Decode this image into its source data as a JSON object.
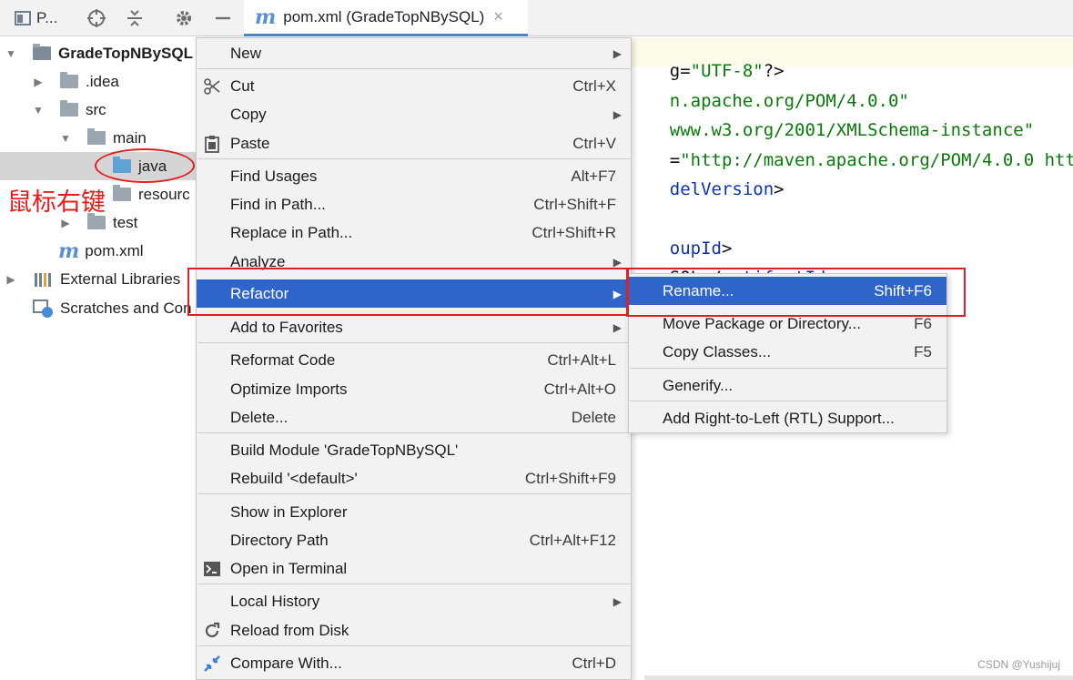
{
  "toolbar": {
    "project_label": "P...",
    "editor_tab": {
      "title": "pom.xml (GradeTopNBySQL)",
      "close": "×"
    }
  },
  "tree": {
    "root": "GradeTopNBySQL",
    "idea": ".idea",
    "src": "src",
    "main": "main",
    "java": "java",
    "resources": "resourc",
    "test": "test",
    "pom": "pom.xml",
    "external_libraries": "External Libraries",
    "scratches": "Scratches and Con"
  },
  "annotation": "鼠标右键",
  "editor": {
    "lines": [
      {
        "a": "g=",
        "b": "\"UTF-8\"",
        "c": "?>"
      },
      {
        "a": "",
        "b": "n.apache.org/POM/4.0.0\"",
        "c": ""
      },
      {
        "a": "",
        "b": "www.w3.org/2001/XMLSchema-instance\"",
        "c": ""
      },
      {
        "a": "=",
        "b": "\"http://maven.apache.org/POM/4.0.0 http:",
        "c": ""
      },
      {
        "a": "",
        "b": "delVersion",
        "c": ">"
      },
      {
        "a": "",
        "b": "oupId",
        "c": ">"
      },
      {
        "a": "SQL</",
        "b": "artifactId",
        "c": ">"
      }
    ]
  },
  "menu": {
    "items": [
      {
        "label": "New",
        "shortcut": "",
        "submenu": true,
        "icon": ""
      },
      {
        "label": "Cut",
        "shortcut": "Ctrl+X",
        "submenu": false,
        "icon": "scissors-icon"
      },
      {
        "label": "Copy",
        "shortcut": "",
        "submenu": true,
        "icon": ""
      },
      {
        "label": "Paste",
        "shortcut": "Ctrl+V",
        "submenu": false,
        "icon": "clipboard-icon"
      },
      {
        "label": "Find Usages",
        "shortcut": "Alt+F7",
        "submenu": false,
        "icon": ""
      },
      {
        "label": "Find in Path...",
        "shortcut": "Ctrl+Shift+F",
        "submenu": false,
        "icon": ""
      },
      {
        "label": "Replace in Path...",
        "shortcut": "Ctrl+Shift+R",
        "submenu": false,
        "icon": ""
      },
      {
        "label": "Analyze",
        "shortcut": "",
        "submenu": true,
        "icon": ""
      },
      {
        "label": "Refactor",
        "shortcut": "",
        "submenu": true,
        "icon": ""
      },
      {
        "label": "Add to Favorites",
        "shortcut": "",
        "submenu": true,
        "icon": ""
      },
      {
        "label": "Reformat Code",
        "shortcut": "Ctrl+Alt+L",
        "submenu": false,
        "icon": ""
      },
      {
        "label": "Optimize Imports",
        "shortcut": "Ctrl+Alt+O",
        "submenu": false,
        "icon": ""
      },
      {
        "label": "Delete...",
        "shortcut": "Delete",
        "submenu": false,
        "icon": ""
      },
      {
        "label": "Build Module 'GradeTopNBySQL'",
        "shortcut": "",
        "submenu": false,
        "icon": ""
      },
      {
        "label": "Rebuild '<default>'",
        "shortcut": "Ctrl+Shift+F9",
        "submenu": false,
        "icon": ""
      },
      {
        "label": "Show in Explorer",
        "shortcut": "",
        "submenu": false,
        "icon": ""
      },
      {
        "label": "Directory Path",
        "shortcut": "Ctrl+Alt+F12",
        "submenu": false,
        "icon": ""
      },
      {
        "label": "Open in Terminal",
        "shortcut": "",
        "submenu": false,
        "icon": "terminal-icon"
      },
      {
        "label": "Local History",
        "shortcut": "",
        "submenu": true,
        "icon": ""
      },
      {
        "label": "Reload from Disk",
        "shortcut": "",
        "submenu": false,
        "icon": "reload-icon"
      },
      {
        "label": "Compare With...",
        "shortcut": "Ctrl+D",
        "submenu": false,
        "icon": "compare-icon"
      }
    ]
  },
  "submenu": {
    "items": [
      {
        "label": "Rename...",
        "shortcut": "Shift+F6"
      },
      {
        "label": "Move Package or Directory...",
        "shortcut": "F6"
      },
      {
        "label": "Copy Classes...",
        "shortcut": "F5"
      },
      {
        "label": "Generify...",
        "shortcut": ""
      },
      {
        "label": "Add Right-to-Left (RTL) Support...",
        "shortcut": ""
      }
    ]
  },
  "watermark": "CSDN @Yushijuj",
  "colors": {
    "menu_highlight": "#2f65ca",
    "annotation_red": "#e02020",
    "maven_blue": "#5b8ed6",
    "xml_string": "#0a7a0a",
    "xml_tag": "#0b33b2"
  }
}
